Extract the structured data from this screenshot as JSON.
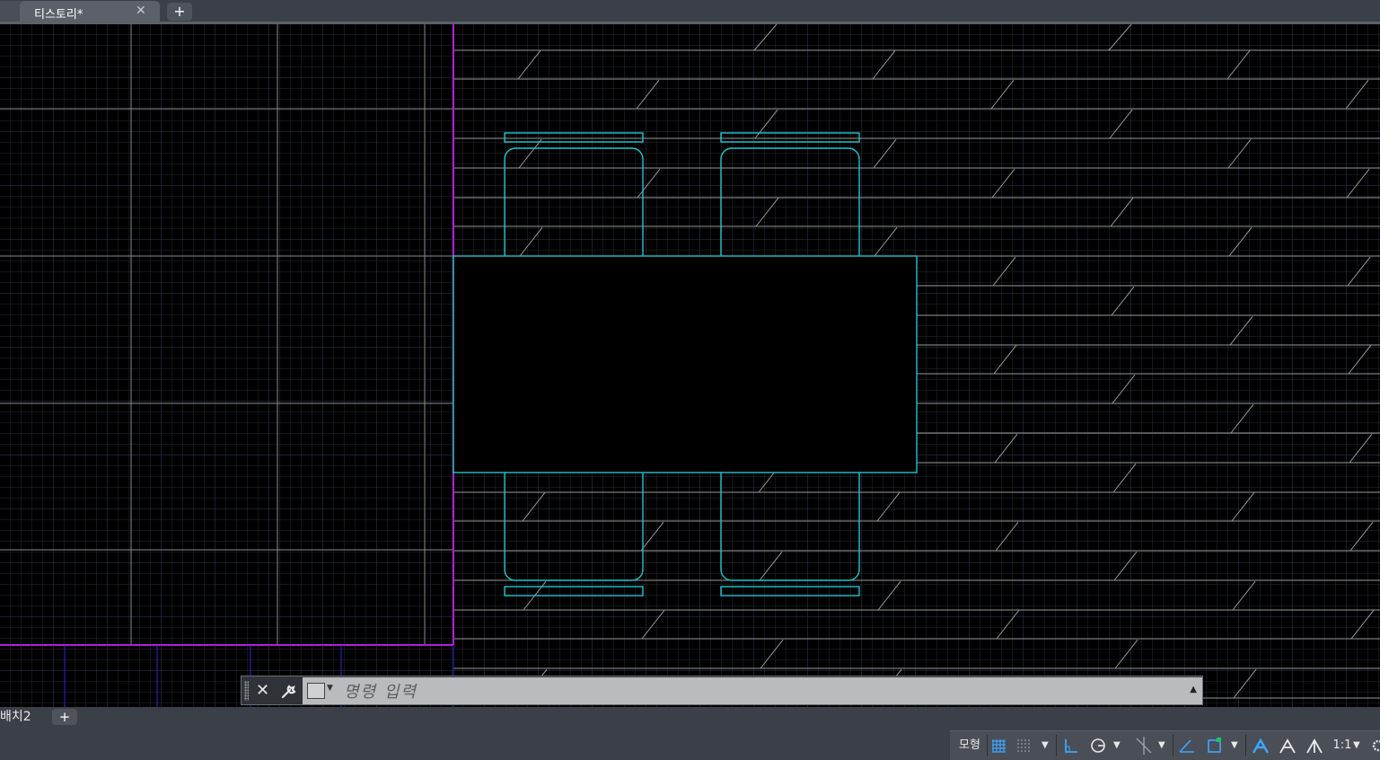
{
  "document_tab": {
    "label": "티스토리*",
    "close_icon": "close-icon",
    "add_icon": "plus-icon"
  },
  "command_line": {
    "placeholder": "명령 입력",
    "close_icon": "close-icon",
    "customize_icon": "wrench-icon",
    "recent_icon": "command-prompt-icon",
    "expand_icon": "triangle-up-icon"
  },
  "layout_tabs": {
    "tab": "배치2",
    "add_icon": "plus-icon"
  },
  "status_bar": {
    "model_label": "모형",
    "scale_label": "1:1",
    "icons": [
      "grid-icon",
      "snap-icon",
      "ortho-icon",
      "polar-icon",
      "osnap-tracking-icon",
      "isodraft-icon",
      "object-snap-icon",
      "annotation-visibility-icon",
      "auto-scale-icon",
      "annotation-scale-icon",
      "gear-icon"
    ]
  },
  "colors": {
    "background": "#000000",
    "cyan_linework": "#1fc6cf",
    "magenta_boundary": "#b21dd6",
    "grey_linework": "#8c8c8c",
    "ui_chrome": "#3b4048",
    "status_blue": "#3ea6ff"
  }
}
